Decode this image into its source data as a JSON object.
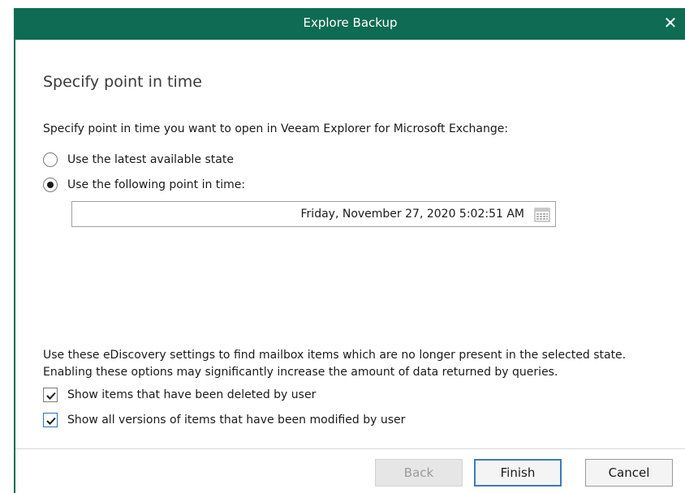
{
  "window": {
    "title": "Explore Backup",
    "close_glyph": "✕"
  },
  "page": {
    "heading": "Specify point in time",
    "description": "Specify point in time you want to open in Veeam Explorer for Microsoft Exchange:"
  },
  "options": {
    "latest_label": "Use the latest available state",
    "latest_selected": false,
    "point_label": "Use the following point in time:",
    "point_selected": true,
    "datetime_value": "Friday, November 27, 2020 5:02:51 AM"
  },
  "ediscovery": {
    "line1": "Use these eDiscovery settings to find mailbox items which are no longer present in the selected state.",
    "line2": "Enabling these options may significantly increase the amount of data returned by queries.",
    "deleted_label": "Show items that have been deleted by user",
    "deleted_checked": true,
    "versions_label": "Show all versions of items that have been modified by user",
    "versions_checked": true
  },
  "buttons": {
    "back": "Back",
    "finish": "Finish",
    "cancel": "Cancel"
  },
  "colors": {
    "accent": "#0f6b53",
    "focus": "#3d7abf"
  }
}
